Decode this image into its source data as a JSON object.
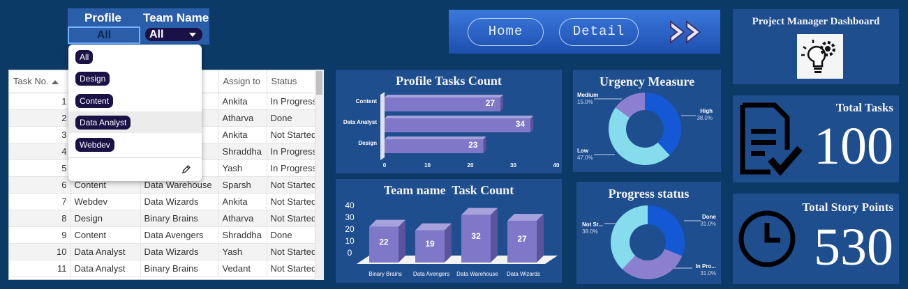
{
  "slicers": {
    "profile_label": "Profile",
    "profile_value": "All",
    "team_label": "Team Name",
    "team_value": "All",
    "profile_options": [
      "All",
      "Design",
      "Content",
      "Data Analyst",
      "Webdev"
    ]
  },
  "table": {
    "headers": [
      "Task No.",
      "",
      "",
      "Assign to",
      "Status"
    ],
    "rows": [
      [
        "1",
        "",
        "",
        "Ankita",
        "In Progress"
      ],
      [
        "2",
        "",
        "",
        "Atharva",
        "Done"
      ],
      [
        "3",
        "",
        "",
        "Ankita",
        "Not Started"
      ],
      [
        "4",
        "",
        "",
        "Shraddha",
        "In Progress"
      ],
      [
        "5",
        "",
        "",
        "Yash",
        "In Progress"
      ],
      [
        "6",
        "Content",
        "Data Warehouse",
        "Sparsh",
        "Not Started"
      ],
      [
        "7",
        "Webdev",
        "Data Wizards",
        "Ankita",
        "Not Started"
      ],
      [
        "8",
        "Design",
        "Binary Brains",
        "Atharva",
        "Not Started"
      ],
      [
        "9",
        "Content",
        "Data Avengers",
        "Shraddha",
        "Done"
      ],
      [
        "10",
        "Data Analyst",
        "Data Wizards",
        "Yash",
        "Not Started"
      ],
      [
        "11",
        "Data Analyst",
        "Binary Brains",
        "Vedant",
        "Not Started"
      ]
    ]
  },
  "nav": {
    "home": "Home",
    "detail": "Detail",
    "forward_icon": "double-chevron-right-icon"
  },
  "header_card": {
    "title": "Project Manager Dashboard",
    "icon": "bulb-gear-icon"
  },
  "kpis": {
    "total_tasks_label": "Total Tasks",
    "total_tasks_value": "100",
    "total_tasks_icon": "document-check-icon",
    "story_points_label": "Total Story Points",
    "story_points_value": "530",
    "story_points_icon": "clock-icon"
  },
  "colors": {
    "background": "#0b3a66",
    "panel": "#1f4e8e",
    "bar": "#7f78c8",
    "donut_blue": "#1558d6",
    "donut_purple": "#8c7fd0",
    "donut_cyan": "#86dcec"
  },
  "chart_data": [
    {
      "type": "bar",
      "orientation": "horizontal",
      "title": "Profile Tasks Count",
      "categories": [
        "Content",
        "Data Analyst",
        "Design"
      ],
      "values": [
        27,
        34,
        23
      ],
      "xlim": [
        0,
        40
      ],
      "ticks": [
        "0",
        "10",
        "20",
        "30",
        "40"
      ]
    },
    {
      "type": "bar",
      "title": "Team name  Task Count",
      "categories": [
        "Binary Brains",
        "Data Avengers",
        "Data Warehouse",
        "Data Wizards"
      ],
      "values": [
        22,
        19,
        32,
        27
      ],
      "ylim": [
        0,
        40
      ],
      "ticks": [
        "0",
        "10",
        "20",
        "30",
        "40"
      ]
    },
    {
      "type": "pie",
      "title": "Urgency Measure",
      "labels": [
        "High",
        "Low",
        "Medium"
      ],
      "values": [
        38.0,
        47.0,
        15.0
      ],
      "value_labels": [
        "38.0%",
        "47.0%",
        "15.0%"
      ]
    },
    {
      "type": "pie",
      "title": "Progress status",
      "labels": [
        "Done",
        "In Pro...",
        "Not St..."
      ],
      "values": [
        31.0,
        31.0,
        38.0
      ],
      "value_labels": [
        "31.0%",
        "31.0%",
        "38.0%"
      ]
    }
  ]
}
